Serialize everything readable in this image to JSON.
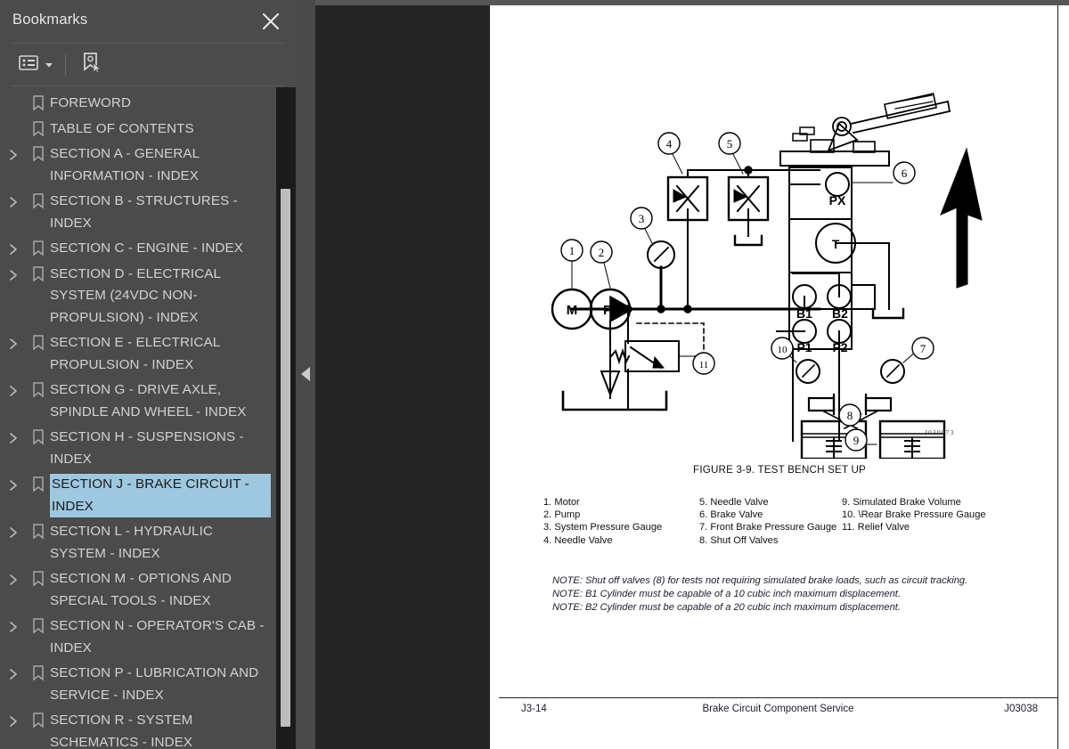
{
  "panel": {
    "title": "Bookmarks",
    "close_icon": "close-icon",
    "toolbar": {
      "list_options_icon": "list-options-icon",
      "dropdown_caret_icon": "chevron-down-icon",
      "new_bookmark_icon": "new-bookmark-icon"
    }
  },
  "bookmarks": [
    {
      "label": "FOREWORD",
      "expandable": false,
      "selected": false
    },
    {
      "label": "TABLE OF CONTENTS",
      "expandable": false,
      "selected": false
    },
    {
      "label": "SECTION A - GENERAL INFORMATION - INDEX",
      "expandable": true,
      "selected": false
    },
    {
      "label": "SECTION B - STRUCTURES - INDEX",
      "expandable": true,
      "selected": false
    },
    {
      "label": "SECTION C - ENGINE - INDEX",
      "expandable": true,
      "selected": false
    },
    {
      "label": "SECTION D - ELECTRICAL SYSTEM (24VDC NON-PROPULSION) - INDEX",
      "expandable": true,
      "selected": false
    },
    {
      "label": "SECTION E - ELECTRICAL PROPULSION - INDEX",
      "expandable": true,
      "selected": false
    },
    {
      "label": "SECTION G - DRIVE AXLE, SPINDLE AND WHEEL - INDEX",
      "expandable": true,
      "selected": false
    },
    {
      "label": "SECTION H - SUSPENSIONS - INDEX",
      "expandable": true,
      "selected": false
    },
    {
      "label": "SECTION J - BRAKE CIRCUIT - INDEX",
      "expandable": true,
      "selected": true
    },
    {
      "label": "SECTION L - HYDRAULIC SYSTEM - INDEX",
      "expandable": true,
      "selected": false
    },
    {
      "label": "SECTION M - OPTIONS AND SPECIAL TOOLS - INDEX",
      "expandable": true,
      "selected": false
    },
    {
      "label": "SECTION N - OPERATOR'S CAB - INDEX",
      "expandable": true,
      "selected": false
    },
    {
      "label": "SECTION P - LUBRICATION AND SERVICE - INDEX",
      "expandable": true,
      "selected": false
    },
    {
      "label": "SECTION R - SYSTEM SCHEMATICS - INDEX",
      "expandable": true,
      "selected": false
    }
  ],
  "document": {
    "figure_caption": "FIGURE 3-9. TEST BENCH SET UP",
    "drawing_id": "J030073",
    "legend": {
      "col1": [
        "1. Motor",
        "2. Pump",
        "3. System Pressure Gauge",
        "4. Needle Valve"
      ],
      "col2": [
        "5. Needle Valve",
        "6. Brake Valve",
        "7. Front Brake Pressure Gauge",
        "8. Shut Off Valves"
      ],
      "col3": [
        "9. Simulated Brake Volume",
        "10. \\Rear Brake Pressure Gauge",
        "11. Relief Valve"
      ]
    },
    "notes": [
      "NOTE: Shut off valves (8) for tests not requiring simulated brake loads, such as circuit tracking.",
      "NOTE: B1 Cylinder must be capable of a 10 cubic inch maximum displacement.",
      "NOTE: B2 Cylinder must be capable of a 20 cubic inch maximum displacement."
    ],
    "footer": {
      "left": "J3-14",
      "center": "Brake Circuit Component Service",
      "right": "J03038"
    },
    "schematic_labels": {
      "motor": "M",
      "pump": "P",
      "port_px": "PX",
      "port_t": "T",
      "port_b1": "B1",
      "port_b2": "B2",
      "port_p1": "P1",
      "port_p2": "P2",
      "callouts": [
        "1",
        "2",
        "3",
        "4",
        "5",
        "6",
        "7",
        "8",
        "9",
        "10",
        "11"
      ]
    }
  },
  "colors": {
    "panel_bg": "#4b4b4b",
    "viewer_bg": "#252525",
    "page_bg": "#ffffff",
    "selection": "#9ec7e0",
    "text": "#d2d2d2",
    "scrollbar_thumb": "#bdbdbd",
    "scrollbar_track": "#1b1b1b"
  }
}
